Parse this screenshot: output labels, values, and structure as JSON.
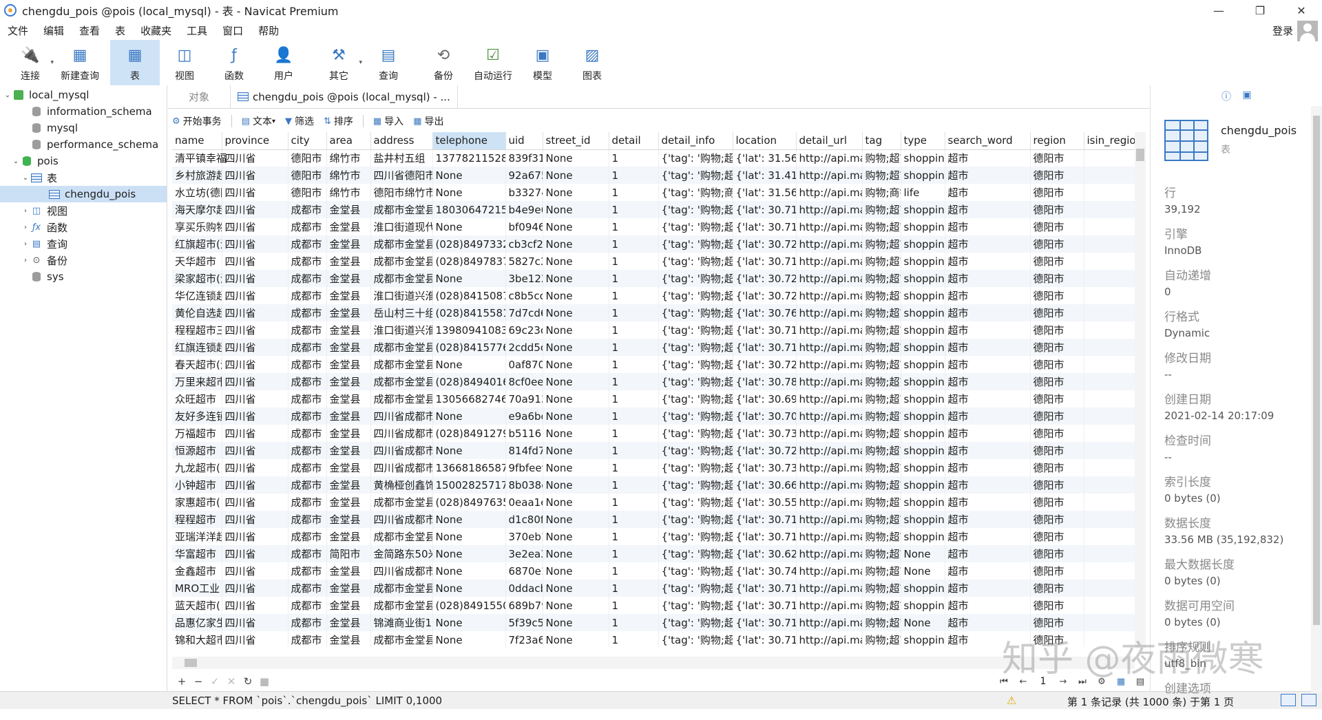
{
  "window": {
    "title": "chengdu_pois @pois (local_mysql) - 表 - Navicat Premium"
  },
  "menu": [
    "文件",
    "编辑",
    "查看",
    "表",
    "收藏夹",
    "工具",
    "窗口",
    "帮助"
  ],
  "login_label": "登录",
  "toolbar": [
    {
      "label": "连接",
      "icon": "plug-icon"
    },
    {
      "label": "新建查询",
      "icon": "new-query-icon"
    },
    {
      "label": "表",
      "icon": "table-icon"
    },
    {
      "label": "视图",
      "icon": "view-icon"
    },
    {
      "label": "函数",
      "icon": "function-icon"
    },
    {
      "label": "用户",
      "icon": "user-icon"
    },
    {
      "label": "其它",
      "icon": "tools-icon"
    },
    {
      "label": "查询",
      "icon": "query-icon"
    },
    {
      "label": "备份",
      "icon": "backup-icon"
    },
    {
      "label": "自动运行",
      "icon": "schedule-icon"
    },
    {
      "label": "模型",
      "icon": "model-icon"
    },
    {
      "label": "图表",
      "icon": "chart-icon"
    }
  ],
  "tree": [
    {
      "label": "local_mysql",
      "arrow": "⌄",
      "type": "conn"
    },
    {
      "label": "information_schema",
      "arrow": "",
      "type": "db"
    },
    {
      "label": "mysql",
      "arrow": "",
      "type": "db"
    },
    {
      "label": "performance_schema",
      "arrow": "",
      "type": "db"
    },
    {
      "label": "pois",
      "arrow": "⌄",
      "type": "db-green"
    },
    {
      "label": "表",
      "arrow": "⌄",
      "type": "tbl"
    },
    {
      "label": "chengdu_pois",
      "arrow": "",
      "type": "tbl"
    },
    {
      "label": "视图",
      "arrow": "›",
      "type": "view"
    },
    {
      "label": "函数",
      "arrow": "›",
      "type": "func"
    },
    {
      "label": "查询",
      "arrow": "›",
      "type": "query"
    },
    {
      "label": "备份",
      "arrow": "›",
      "type": "backup"
    },
    {
      "label": "sys",
      "arrow": "",
      "type": "db"
    }
  ],
  "tabs": {
    "objects": "对象",
    "active": "chengdu_pois @pois (local_mysql) - ..."
  },
  "subtoolbar": [
    "开始事务",
    "文本",
    "筛选",
    "排序",
    "导入",
    "导出"
  ],
  "columns": [
    "name",
    "province",
    "city",
    "area",
    "address",
    "telephone",
    "uid",
    "street_id",
    "detail",
    "detail_info",
    "location",
    "detail_url",
    "tag",
    "type",
    "search_word",
    "region",
    "isin_regio"
  ],
  "rows": [
    [
      "清平镇幸福",
      "四川省",
      "德阳市",
      "绵竹市",
      "盐井村五组",
      "13778211528",
      "839f31",
      "None",
      "1",
      "{'tag': '购物;超市",
      "{'lat': 31.568",
      "http://api.ma",
      "购物;超市",
      "shopping",
      "超市",
      "德阳市",
      ""
    ],
    [
      "乡村旅游超",
      "四川省",
      "德阳市",
      "绵竹市",
      "四川省德阳市",
      "None",
      "92a675",
      "None",
      "1",
      "{'tag': '购物;超市",
      "{'lat': 31.415",
      "http://api.ma",
      "购物;超市",
      "shopping",
      "超市",
      "德阳市",
      ""
    ],
    [
      "水立坊(德阳",
      "四川省",
      "德阳市",
      "绵竹市",
      "德阳市绵竹市",
      "None",
      "b33274",
      "None",
      "1",
      "{'tag': '购物;商铺",
      "{'lat': 31.561",
      "http://api.ma",
      "购物;商铺",
      "life",
      "超市",
      "德阳市",
      ""
    ],
    [
      "海天摩尔超",
      "四川省",
      "成都市",
      "金堂县",
      "成都市金堂县",
      "18030647215",
      "b4e9e6",
      "None",
      "1",
      "{'tag': '购物;超市",
      "{'lat': 30.718",
      "http://api.ma",
      "购物;超市",
      "shopping",
      "超市",
      "德阳市",
      ""
    ],
    [
      "享买乐购物",
      "四川省",
      "成都市",
      "金堂县",
      "淮口街道现代",
      "None",
      "bf0946",
      "None",
      "1",
      "{'tag': '购物;超市",
      "{'lat': 30.719",
      "http://api.ma",
      "购物;超市",
      "shopping",
      "超市",
      "德阳市",
      ""
    ],
    [
      "红旗超市(淮",
      "四川省",
      "成都市",
      "金堂县",
      "成都市金堂县",
      "(028)84973329",
      "cb3cf2",
      "None",
      "1",
      "{'tag': '购物;超市",
      "{'lat': 30.721",
      "http://api.ma",
      "购物;超市",
      "shopping",
      "超市",
      "德阳市",
      ""
    ],
    [
      "天华超市",
      "四川省",
      "成都市",
      "金堂县",
      "成都市金堂县",
      "(028)84978377",
      "5827c3",
      "None",
      "1",
      "{'tag': '购物;超市",
      "{'lat': 30.718",
      "http://api.ma",
      "购物;超市",
      "shopping",
      "超市",
      "德阳市",
      ""
    ],
    [
      "梁家超市(淮",
      "四川省",
      "成都市",
      "金堂县",
      "成都市金堂县",
      "None",
      "3be122",
      "None",
      "1",
      "{'tag': '购物;超市",
      "{'lat': 30.721",
      "http://api.ma",
      "购物;超市",
      "shopping",
      "超市",
      "德阳市",
      ""
    ],
    [
      "华亿连锁超",
      "四川省",
      "成都市",
      "金堂县",
      "淮口街道兴淮",
      "(028)84150879",
      "c8b5cc",
      "None",
      "1",
      "{'tag': '购物;超市",
      "{'lat': 30.721",
      "http://api.ma",
      "购物;超市",
      "shopping",
      "超市",
      "德阳市",
      ""
    ],
    [
      "黄伦自选超",
      "四川省",
      "成都市",
      "金堂县",
      "岳山村三十组",
      "(028)84155819",
      "7d7cd6",
      "None",
      "1",
      "{'tag': '购物;超市",
      "{'lat': 30.763",
      "http://api.ma",
      "购物;超市",
      "shopping",
      "超市",
      "德阳市",
      ""
    ],
    [
      "程程超市三",
      "四川省",
      "成都市",
      "金堂县",
      "淮口街道兴淮",
      "13980941083",
      "69c23c",
      "None",
      "1",
      "{'tag': '购物;超市",
      "{'lat': 30.719",
      "http://api.ma",
      "购物;超市",
      "shopping",
      "超市",
      "德阳市",
      ""
    ],
    [
      "红旗连锁超",
      "四川省",
      "成都市",
      "金堂县",
      "成都市金堂县",
      "(028)84157769",
      "2cdd5c",
      "None",
      "1",
      "{'tag': '购物;超市",
      "{'lat': 30.717",
      "http://api.ma",
      "购物;超市",
      "shopping",
      "超市",
      "德阳市",
      ""
    ],
    [
      "春天超市(淮",
      "四川省",
      "成都市",
      "金堂县",
      "成都市金堂县",
      "None",
      "0af870",
      "None",
      "1",
      "{'tag': '购物;超市",
      "{'lat': 30.721",
      "http://api.ma",
      "购物;超市",
      "shopping",
      "超市",
      "德阳市",
      ""
    ],
    [
      "万里来超市",
      "四川省",
      "成都市",
      "金堂县",
      "成都市金堂县",
      "(028)84940164",
      "8cf0ee",
      "None",
      "1",
      "{'tag': '购物;超市",
      "{'lat': 30.786",
      "http://api.ma",
      "购物;超市",
      "shopping",
      "超市",
      "德阳市",
      ""
    ],
    [
      "众旺超市",
      "四川省",
      "成都市",
      "金堂县",
      "成都市金堂县",
      "13056682746",
      "70a913",
      "None",
      "1",
      "{'tag': '购物;超市",
      "{'lat': 30.692",
      "http://api.ma",
      "购物;超市",
      "shopping",
      "超市",
      "德阳市",
      ""
    ],
    [
      "友好多连锁",
      "四川省",
      "成都市",
      "金堂县",
      "四川省成都市",
      "None",
      "e9a6bc",
      "None",
      "1",
      "{'tag': '购物;超市",
      "{'lat': 30.707",
      "http://api.ma",
      "购物;超市",
      "shopping",
      "超市",
      "德阳市",
      ""
    ],
    [
      "万福超市",
      "四川省",
      "成都市",
      "金堂县",
      "四川省成都市",
      "(028)84912797",
      "b5116",
      "None",
      "1",
      "{'tag': '购物;超市",
      "{'lat': 30.737",
      "http://api.ma",
      "购物;超市",
      "shopping",
      "超市",
      "德阳市",
      ""
    ],
    [
      "恒源超市",
      "四川省",
      "成都市",
      "金堂县",
      "四川省成都市",
      "None",
      "814fd7",
      "None",
      "1",
      "{'tag': '购物;超市",
      "{'lat': 30.725",
      "http://api.ma",
      "购物;超市",
      "shopping",
      "超市",
      "德阳市",
      ""
    ],
    [
      "九龙超市(白",
      "四川省",
      "成都市",
      "金堂县",
      "四川省成都市",
      "13668186587",
      "9fbfeef",
      "None",
      "1",
      "{'tag': '购物;超市",
      "{'lat': 30.732",
      "http://api.ma",
      "购物;超市",
      "shopping",
      "超市",
      "德阳市",
      ""
    ],
    [
      "小钟超市",
      "四川省",
      "成都市",
      "金堂县",
      "黄桷桠创鑫饰",
      "15002825717",
      "8b038c",
      "None",
      "1",
      "{'tag': '购物;超市",
      "{'lat': 30.667",
      "http://api.ma",
      "购物;超市",
      "shopping",
      "超市",
      "德阳市",
      ""
    ],
    [
      "家惠超市(白",
      "四川省",
      "成都市",
      "金堂县",
      "成都市金堂县",
      "(028)84976351",
      "0eaa1e",
      "None",
      "1",
      "{'tag': '购物;超市",
      "{'lat': 30.556",
      "http://api.ma",
      "购物;超市",
      "shopping",
      "超市",
      "德阳市",
      ""
    ],
    [
      "程程超市",
      "四川省",
      "成都市",
      "金堂县",
      "四川省成都市",
      "None",
      "d1c80f",
      "None",
      "1",
      "{'tag': '购物;超市",
      "{'lat': 30.714",
      "http://api.ma",
      "购物;超市",
      "shopping",
      "超市",
      "德阳市",
      ""
    ],
    [
      "亚瑞洋洋超",
      "四川省",
      "成都市",
      "金堂县",
      "成都市金堂县",
      "None",
      "370eb1",
      "None",
      "1",
      "{'tag': '购物;超市",
      "{'lat': 30.717",
      "http://api.ma",
      "购物;超市",
      "shopping",
      "超市",
      "德阳市",
      ""
    ],
    [
      "华富超市",
      "四川省",
      "成都市",
      "简阳市",
      "金简路东50米",
      "None",
      "3e2ea3",
      "None",
      "1",
      "{'tag': '购物;超市",
      "{'lat': 30.620",
      "http://api.ma",
      "购物;超市",
      "None",
      "超市",
      "德阳市",
      ""
    ],
    [
      "金鑫超市",
      "四川省",
      "成都市",
      "金堂县",
      "四川省成都市",
      "None",
      "6870e1",
      "None",
      "1",
      "{'tag': '购物;超市",
      "{'lat': 30.748",
      "http://api.ma",
      "购物;超市",
      "None",
      "超市",
      "德阳市",
      ""
    ],
    [
      "MRO工业",
      "四川省",
      "成都市",
      "金堂县",
      "成都市金堂县",
      "None",
      "0ddacb",
      "None",
      "1",
      "{'tag': '购物;超市",
      "{'lat': 30.712",
      "http://api.ma",
      "购物;超市",
      "shopping",
      "超市",
      "德阳市",
      ""
    ],
    [
      "蓝天超市(白",
      "四川省",
      "成都市",
      "金堂县",
      "成都市金堂县",
      "(028)84915507",
      "689b79",
      "None",
      "1",
      "{'tag': '购物;超市",
      "{'lat': 30.717",
      "http://api.ma",
      "购物;超市",
      "shopping",
      "超市",
      "德阳市",
      ""
    ],
    [
      "品惠亿家生",
      "四川省",
      "成都市",
      "金堂县",
      "锦滩商业街1",
      "None",
      "5f39c5",
      "None",
      "1",
      "{'tag': '购物;超市",
      "{'lat': 30.717",
      "http://api.ma",
      "购物;超市",
      "None",
      "超市",
      "德阳市",
      ""
    ],
    [
      "锦和大超市",
      "四川省",
      "成都市",
      "金堂县",
      "成都市金堂县",
      "None",
      "7f23a6",
      "None",
      "1",
      "{'tag': '购物;超市",
      "{'lat': 30.715",
      "http://api.ma",
      "购物;超市",
      "shopping",
      "超市",
      "德阳市",
      ""
    ]
  ],
  "pager": {
    "page": "1"
  },
  "status": {
    "sql": "SELECT * FROM `pois`.`chengdu_pois` LIMIT 0,1000",
    "records": "第 1 条记录 (共 1000 条) 于第 1 页"
  },
  "info_panel": {
    "name": "chengdu_pois",
    "kind": "表",
    "props": [
      {
        "k": "行",
        "v": "39,192"
      },
      {
        "k": "引擎",
        "v": "InnoDB"
      },
      {
        "k": "自动递增",
        "v": "0"
      },
      {
        "k": "行格式",
        "v": "Dynamic"
      },
      {
        "k": "修改日期",
        "v": "--"
      },
      {
        "k": "创建日期",
        "v": "2021-02-14 20:17:09"
      },
      {
        "k": "检查时间",
        "v": "--"
      },
      {
        "k": "索引长度",
        "v": "0 bytes (0)"
      },
      {
        "k": "数据长度",
        "v": "33.56 MB (35,192,832)"
      },
      {
        "k": "最大数据长度",
        "v": "0 bytes (0)"
      },
      {
        "k": "数据可用空间",
        "v": "0 bytes (0)"
      },
      {
        "k": "排序规则",
        "v": "utf8_bin"
      },
      {
        "k": "创建选项",
        "v": ""
      }
    ]
  },
  "watermark": "知乎 @夜雨微寒"
}
